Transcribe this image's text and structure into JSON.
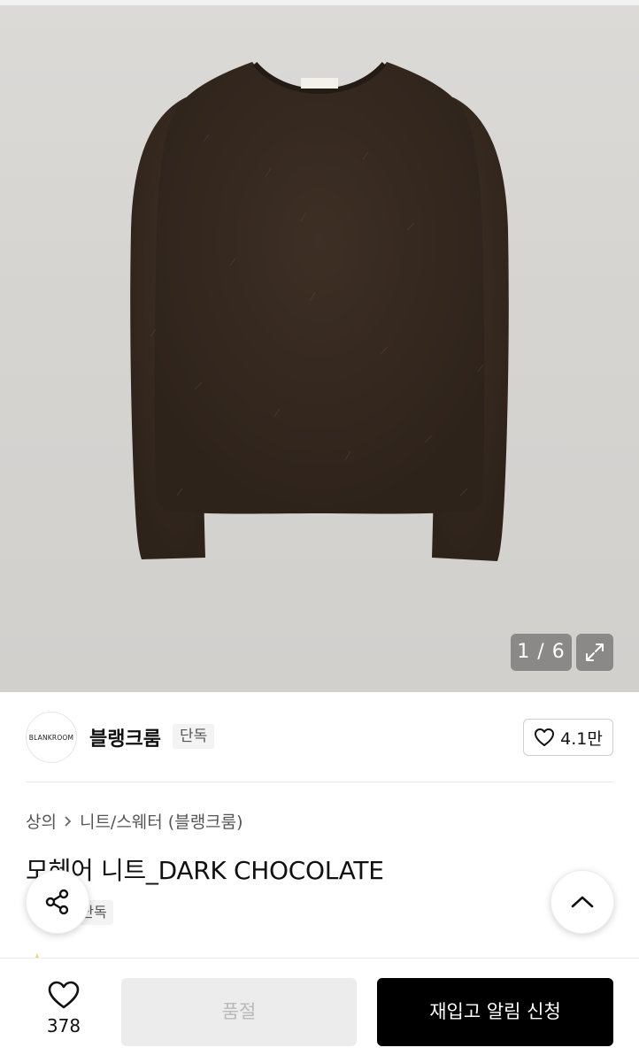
{
  "gallery": {
    "counter": "1 / 6",
    "garment_label": "BLANKROOM"
  },
  "brand": {
    "logo_text": "BLANKROOM",
    "name": "블랭크룸",
    "tag": "단독",
    "likes": "4.1만"
  },
  "breadcrumb": {
    "items": [
      "상의",
      "니트/스웨터 (블랭크룸)"
    ]
  },
  "product": {
    "title": "모헤어 니트_DARK CHOCOLATE",
    "exclusive_label": "단독"
  },
  "bottom_bar": {
    "like_count": "378",
    "soldout_label": "품절",
    "restock_label": "재입고 알림 신청"
  },
  "colors": {
    "sweater": "#3a2c22",
    "background": "#d6d4d1",
    "primary_button": "#000000",
    "disabled_button": "#ececec"
  }
}
